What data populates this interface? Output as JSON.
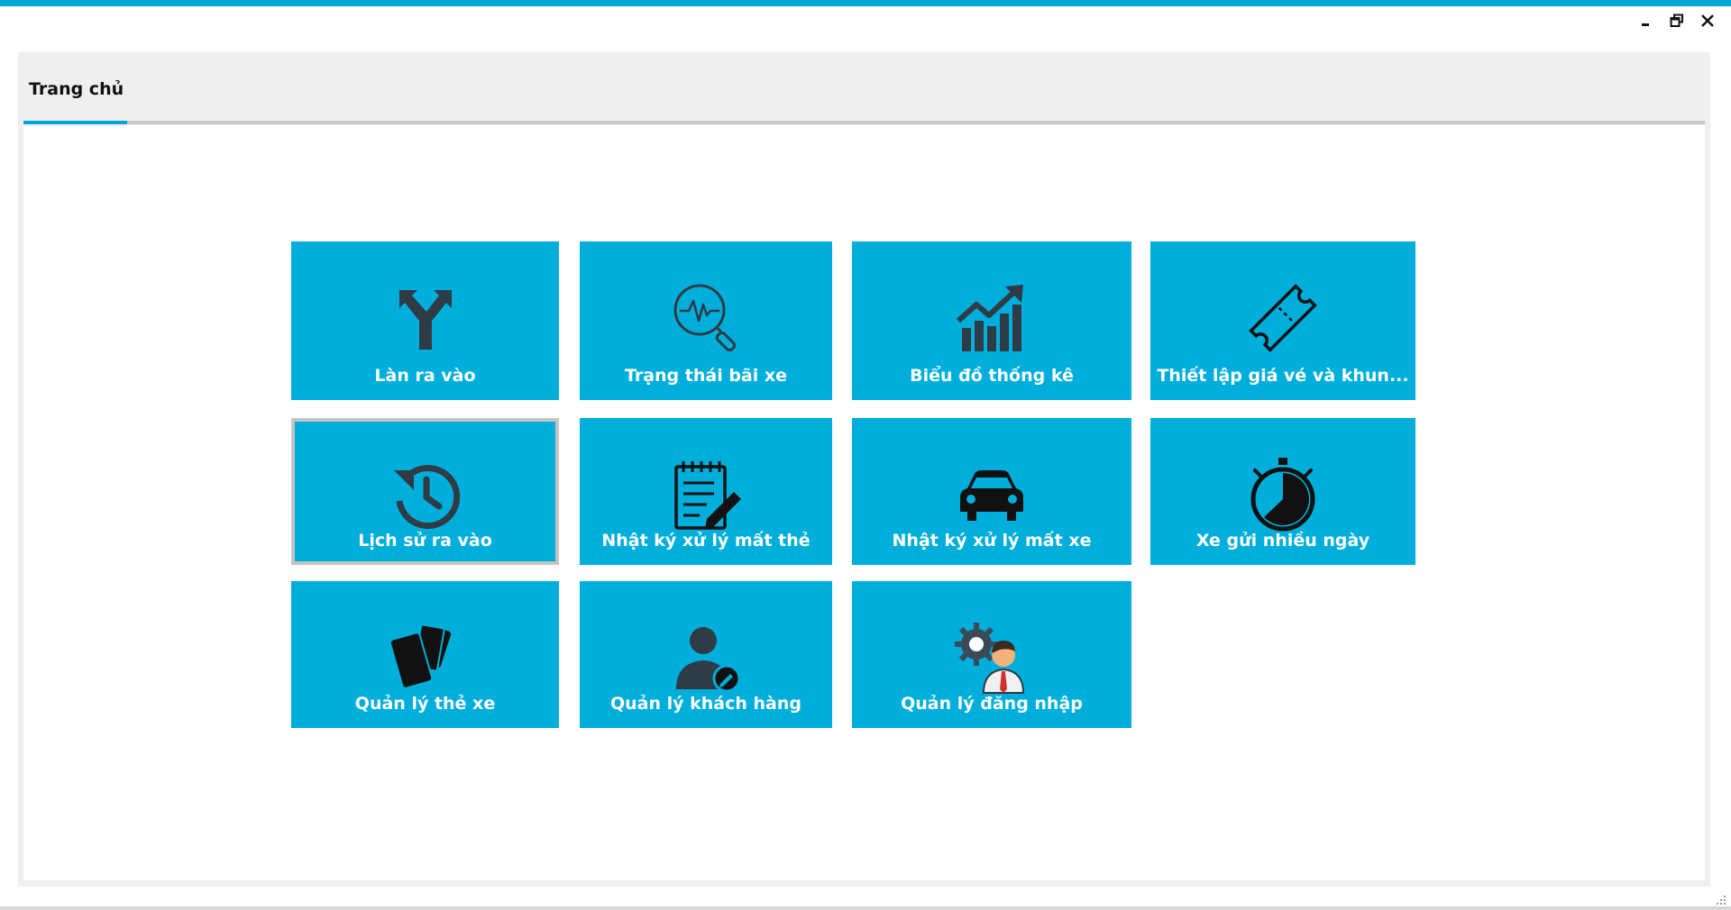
{
  "colors": {
    "accent": "#00a8d6",
    "tile": "#00aedb",
    "icon_dark": "#2f3b45",
    "tile_text": "#ffffff"
  },
  "window_controls": {
    "minimize_icon": "minimize-icon",
    "restore_icon": "restore-icon",
    "close_icon": "close-icon"
  },
  "tabs": [
    {
      "label": "Trang chủ",
      "active": true
    }
  ],
  "tiles": [
    {
      "label": "Làn ra vào",
      "icon": "fork-arrow-icon"
    },
    {
      "label": "Trạng thái bãi xe",
      "icon": "pulse-search-icon"
    },
    {
      "label": "Biểu đồ thống kê",
      "icon": "bar-chart-trend-icon"
    },
    {
      "label": "Thiết lập giá vé và khun...",
      "icon": "ticket-icon"
    },
    {
      "label": "Lịch sử ra vào",
      "icon": "history-clock-icon",
      "selected": true
    },
    {
      "label": "Nhật ký xử lý mất thẻ",
      "icon": "notepad-pencil-icon"
    },
    {
      "label": "Nhật ký xử lý mất  xe",
      "icon": "car-icon"
    },
    {
      "label": "Xe gửi nhiều ngày",
      "icon": "stopwatch-icon"
    },
    {
      "label": "Quản lý thẻ xe",
      "icon": "cards-icon"
    },
    {
      "label": "Quản lý khách hàng",
      "icon": "user-edit-icon"
    },
    {
      "label": "Quản lý đăng nhập",
      "icon": "admin-gear-icon"
    }
  ]
}
